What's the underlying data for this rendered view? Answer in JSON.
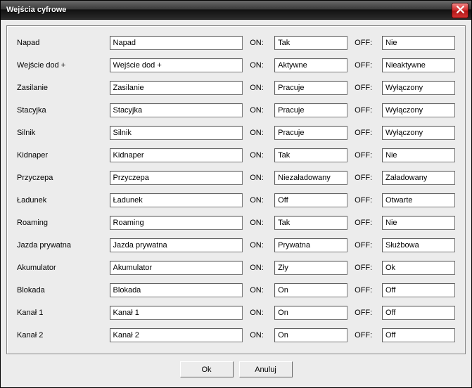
{
  "window": {
    "title": "Wejścia cyfrowe"
  },
  "labels": {
    "on": "ON:",
    "off": "OFF:"
  },
  "rows": [
    {
      "label": "Napad",
      "name": "Napad",
      "on": "Tak",
      "off": "Nie"
    },
    {
      "label": "Wejście dod +",
      "name": "Wejście dod +",
      "on": "Aktywne",
      "off": "Nieaktywne"
    },
    {
      "label": "Zasilanie",
      "name": "Zasilanie",
      "on": "Pracuje",
      "off": "Wyłączony"
    },
    {
      "label": "Stacyjka",
      "name": "Stacyjka",
      "on": "Pracuje",
      "off": "Wyłączony"
    },
    {
      "label": "Silnik",
      "name": "Silnik",
      "on": "Pracuje",
      "off": "Wyłączony"
    },
    {
      "label": "Kidnaper",
      "name": "Kidnaper",
      "on": "Tak",
      "off": "Nie"
    },
    {
      "label": "Przyczepa",
      "name": "Przyczepa",
      "on": "Niezaładowany",
      "off": "Załadowany"
    },
    {
      "label": "Ładunek",
      "name": "Ładunek",
      "on": "Off",
      "off": "Otwarte"
    },
    {
      "label": "Roaming",
      "name": "Roaming",
      "on": "Tak",
      "off": "Nie"
    },
    {
      "label": "Jazda prywatna",
      "name": "Jazda prywatna",
      "on": "Prywatna",
      "off": "Służbowa"
    },
    {
      "label": "Akumulator",
      "name": "Akumulator",
      "on": "Zły",
      "off": "Ok"
    },
    {
      "label": "Blokada",
      "name": "Blokada",
      "on": "On",
      "off": "Off"
    },
    {
      "label": "Kanał 1",
      "name": "Kanał 1",
      "on": "On",
      "off": "Off"
    },
    {
      "label": "Kanał 2",
      "name": "Kanał 2",
      "on": "On",
      "off": "Off"
    }
  ],
  "buttons": {
    "ok": "Ok",
    "cancel": "Anuluj"
  }
}
